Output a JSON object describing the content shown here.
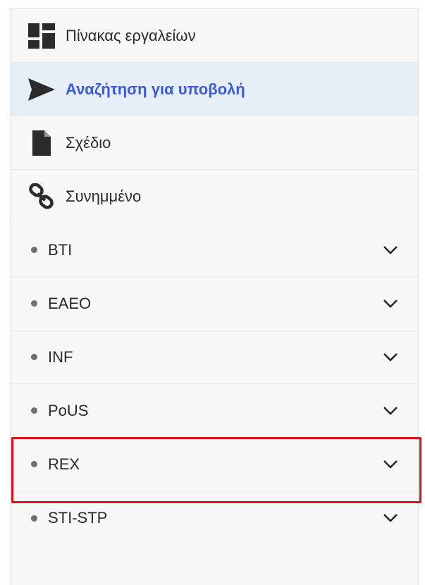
{
  "menu": {
    "items": [
      {
        "label": "Πίνακας εργαλείων",
        "icon": "dashboard-icon"
      },
      {
        "label": "Αναζήτηση για υποβολή",
        "icon": "send-icon",
        "active": true
      },
      {
        "label": "Σχέδιο",
        "icon": "document-icon"
      },
      {
        "label": "Συνημμένο",
        "icon": "link-icon"
      }
    ],
    "groups": [
      {
        "label": "BTI"
      },
      {
        "label": "EAEO"
      },
      {
        "label": "INF"
      },
      {
        "label": "PoUS"
      },
      {
        "label": "REX",
        "highlighted": true
      },
      {
        "label": "STI-STP"
      }
    ]
  },
  "colors": {
    "active_text": "#3b5bdb",
    "active_bg": "#e6eef8",
    "highlight_border": "#e0151b"
  }
}
